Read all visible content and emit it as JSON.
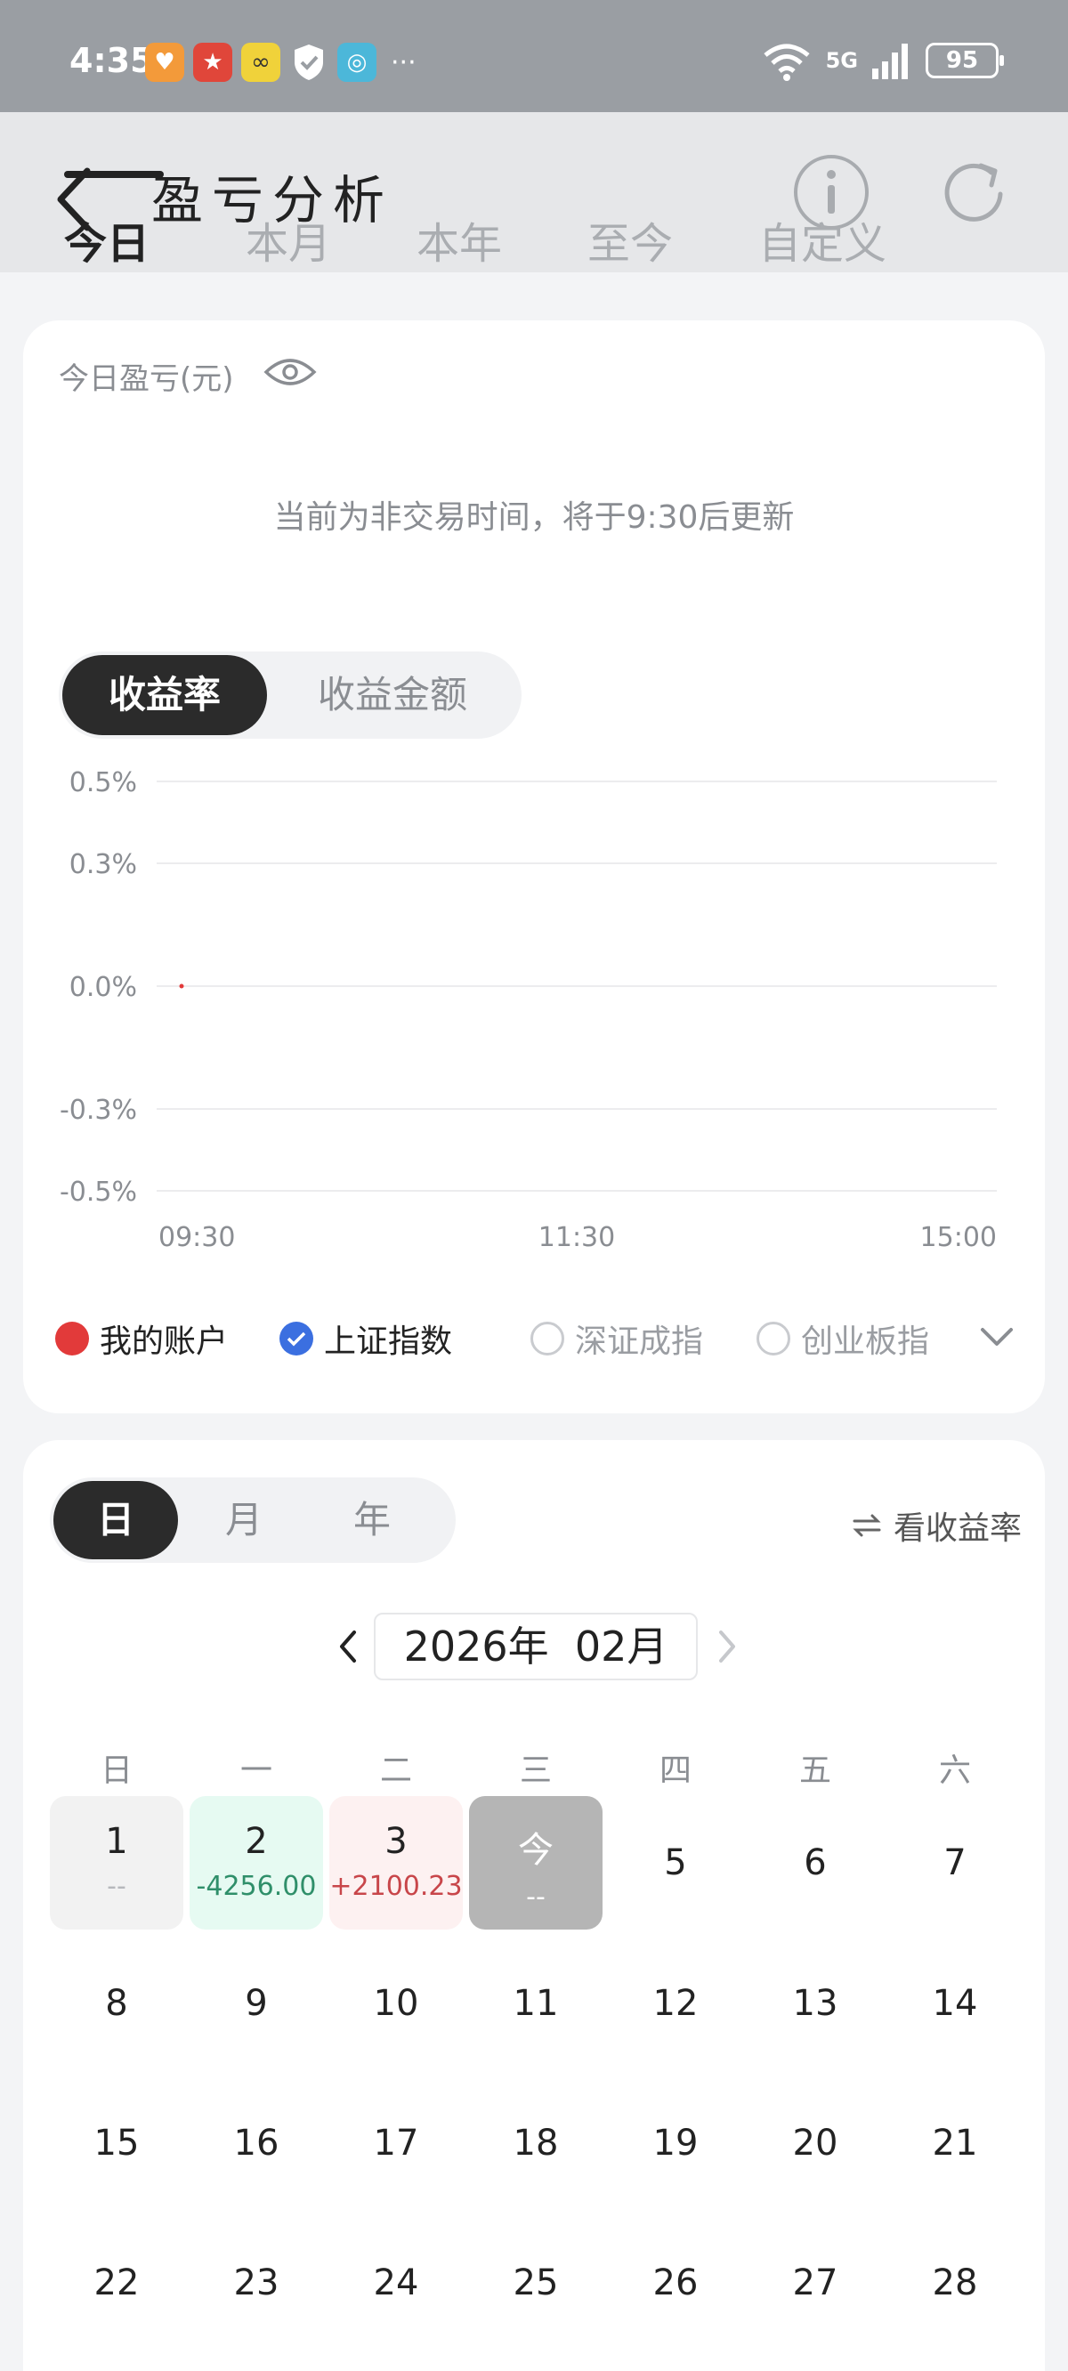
{
  "status_bar": {
    "time": "4:35",
    "network": "5G",
    "battery": "95",
    "more": "···"
  },
  "header": {
    "title": "盈亏分析",
    "period_tabs": [
      "今日",
      "本月",
      "本年",
      "至今",
      "自定义"
    ],
    "active_tab": 0
  },
  "today_card": {
    "pnl_label": "今日盈亏(元)",
    "notice": "当前为非交易时间，将于9:30后更新",
    "mode_tabs": [
      "收益率",
      "收益金额"
    ],
    "active_mode": 0
  },
  "chart_data": {
    "type": "line",
    "y_ticks": [
      "0.5%",
      "0.3%",
      "0.0%",
      "-0.3%",
      "-0.5%"
    ],
    "x_ticks": [
      "09:30",
      "11:30",
      "15:00"
    ],
    "ylim": [
      -0.5,
      0.5
    ],
    "grid": true,
    "series": [
      {
        "name": "我的账户",
        "x": [
          "09:30"
        ],
        "values": [
          0.0
        ]
      }
    ]
  },
  "legend": [
    {
      "label": "我的账户",
      "state": "active"
    },
    {
      "label": "上证指数",
      "state": "checked"
    },
    {
      "label": "深证成指",
      "state": "off"
    },
    {
      "label": "创业板指",
      "state": "off"
    }
  ],
  "calendar": {
    "granularity_tabs": [
      "日",
      "月",
      "年"
    ],
    "active_granularity": 0,
    "view_rate": "看收益率",
    "month_label": "2026年  02月",
    "weekdays": [
      "日",
      "一",
      "二",
      "三",
      "四",
      "五",
      "六"
    ],
    "days": [
      {
        "day": "1",
        "pnl": "--",
        "kind": "neutral"
      },
      {
        "day": "2",
        "pnl": "-4256.00",
        "kind": "loss"
      },
      {
        "day": "3",
        "pnl": "+2100.23",
        "kind": "gain"
      },
      {
        "day": "今",
        "pnl": "--",
        "kind": "today"
      },
      {
        "day": "5"
      },
      {
        "day": "6"
      },
      {
        "day": "7"
      },
      {
        "day": "8"
      },
      {
        "day": "9"
      },
      {
        "day": "10"
      },
      {
        "day": "11"
      },
      {
        "day": "12"
      },
      {
        "day": "13"
      },
      {
        "day": "14"
      },
      {
        "day": "15"
      },
      {
        "day": "16"
      },
      {
        "day": "17"
      },
      {
        "day": "18"
      },
      {
        "day": "19"
      },
      {
        "day": "20"
      },
      {
        "day": "21"
      },
      {
        "day": "22"
      },
      {
        "day": "23"
      },
      {
        "day": "24"
      },
      {
        "day": "25"
      },
      {
        "day": "26"
      },
      {
        "day": "27"
      },
      {
        "day": "28"
      }
    ]
  },
  "colors": {
    "gain": "#c8464a",
    "loss": "#2f8f6a",
    "account_series": "#e23a3a",
    "index_checked": "#3b6fe0"
  }
}
